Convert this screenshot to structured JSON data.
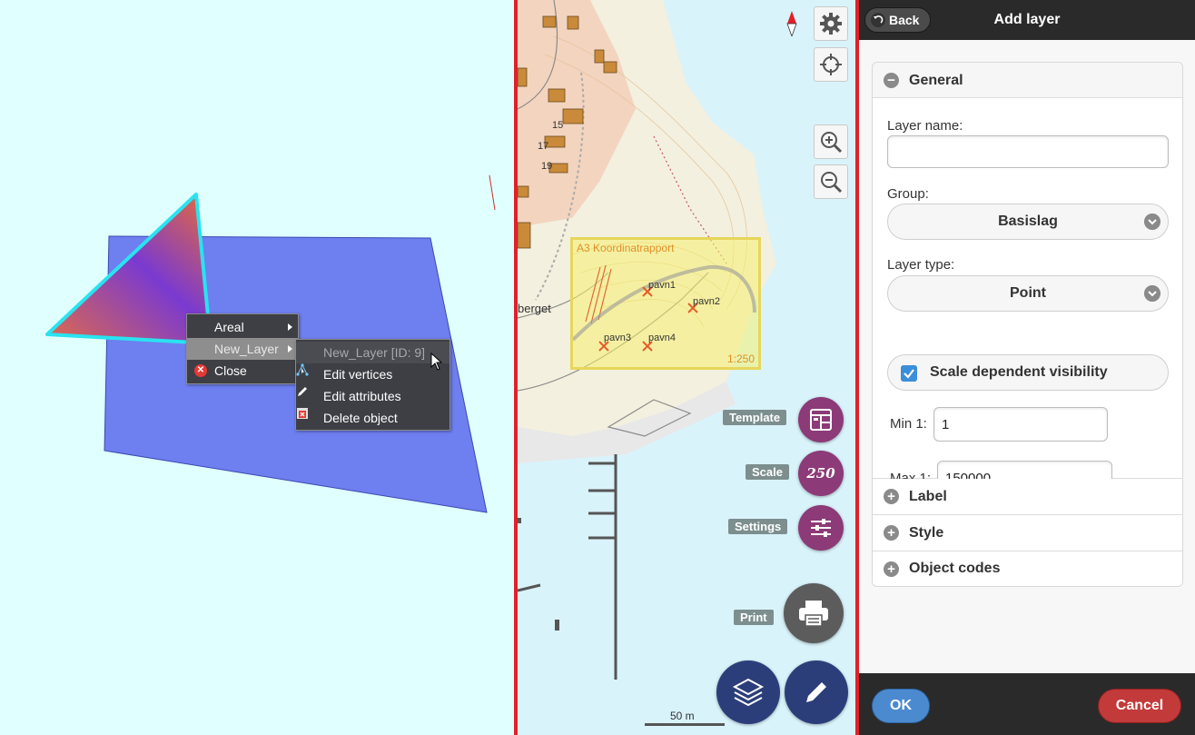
{
  "context_menu": {
    "items": [
      "Areal",
      "New_Layer",
      "Close"
    ],
    "submenu": {
      "header": "New_Layer [ID: 9]",
      "items": [
        "Edit vertices",
        "Edit attributes",
        "Delete object"
      ]
    }
  },
  "map": {
    "labels": [
      "15",
      "17",
      "19",
      "berget"
    ],
    "print_area": {
      "title": "A3 Koordinatrapport",
      "scale": "1:250",
      "points": [
        "pavn1",
        "pavn2",
        "pavn3",
        "pavn4"
      ]
    },
    "scale_bar": "50 m",
    "fabs": {
      "template_label": "Template",
      "scale_label": "Scale",
      "scale_value": "250",
      "settings_label": "Settings",
      "print_label": "Print"
    },
    "colors": {
      "accent_purple": "#8c3a78",
      "accent_navy": "#2c3e7a",
      "divider_red": "#e0202a"
    }
  },
  "panel": {
    "back_label": "Back",
    "title": "Add layer",
    "sections": {
      "general": "General",
      "label": "Label",
      "style": "Style",
      "object_codes": "Object codes"
    },
    "fields": {
      "layer_name_label": "Layer name:",
      "layer_name_value": "",
      "group_label": "Group:",
      "group_value": "Basislag",
      "layer_type_label": "Layer type:",
      "layer_type_value": "Point",
      "scale_visibility_label": "Scale dependent visibility",
      "scale_visibility_checked": true,
      "min_label": "Min 1:",
      "min_value": "1",
      "max_label": "Max 1:",
      "max_value": "150000"
    },
    "ok_label": "OK",
    "cancel_label": "Cancel"
  }
}
